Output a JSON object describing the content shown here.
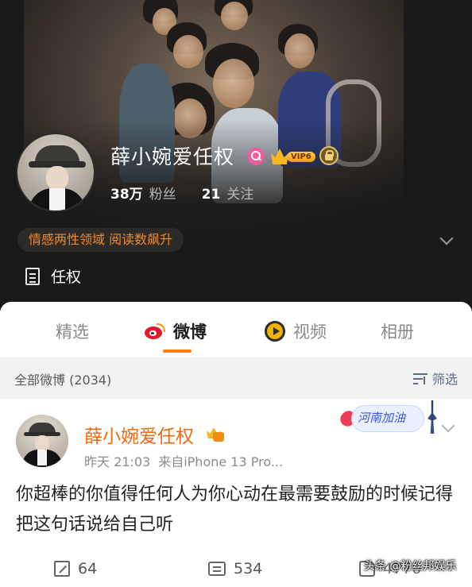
{
  "profile": {
    "name": "薛小婉爱任权",
    "vip_level": "VIP6",
    "followers_count": "38万",
    "followers_label": "粉丝",
    "following_count": "21",
    "following_label": "关注",
    "tag": "情感两性领域 阅读数飙升",
    "bio": "任权"
  },
  "tabs": [
    {
      "label": "精选"
    },
    {
      "label": "微博"
    },
    {
      "label": "视频"
    },
    {
      "label": "相册"
    }
  ],
  "active_tab": "微博",
  "filter": {
    "title": "全部微博 (2034)",
    "button_label": "筛选"
  },
  "post": {
    "author": "薛小婉爱任权",
    "time": "昨天 21:03",
    "source": "来自iPhone 13 Pro...",
    "sticker_text": "河南加油",
    "text": "你超棒的你值得任何人为你心动在最需要鼓励的时候记得把这句话说给自己听",
    "share_count": "64",
    "comment_count": "534",
    "like_count": "4770"
  },
  "watermark": "头条 @粉丝邦娱乐",
  "colors": {
    "accent_orange": "#ff8200",
    "author_orange": "#f06a0f",
    "tag_orange": "#f08a2c",
    "filter_blue": "#5b6b8c"
  }
}
